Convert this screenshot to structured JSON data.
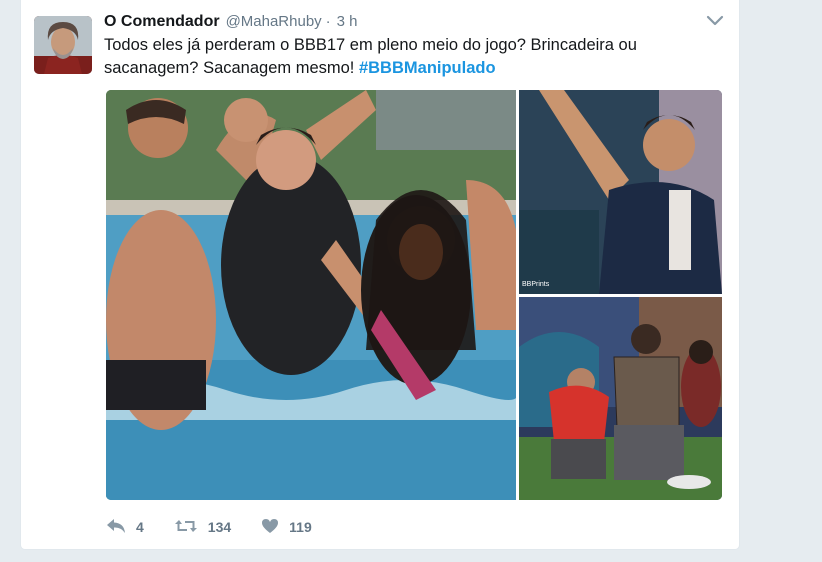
{
  "tweet": {
    "author_name": "O Comendador",
    "handle": "@MahaRhuby",
    "separator": "·",
    "time": "3 h",
    "text_part1": "Todos eles já perderam o BBB17 em pleno meio do jogo?  Brincadeira ou sacanagem? Sacanagem mesmo! ",
    "hashtag": "#BBBManipulado",
    "watermark": "BBPrints"
  },
  "actions": {
    "reply_count": "4",
    "retweet_count": "134",
    "like_count": "119"
  },
  "colors": {
    "hashtag": "#1b95e0",
    "muted": "#657786",
    "background": "#e6ecf0"
  },
  "icons": {
    "reply": "reply-icon",
    "retweet": "retweet-icon",
    "like": "heart-icon",
    "menu": "chevron-down-icon"
  }
}
